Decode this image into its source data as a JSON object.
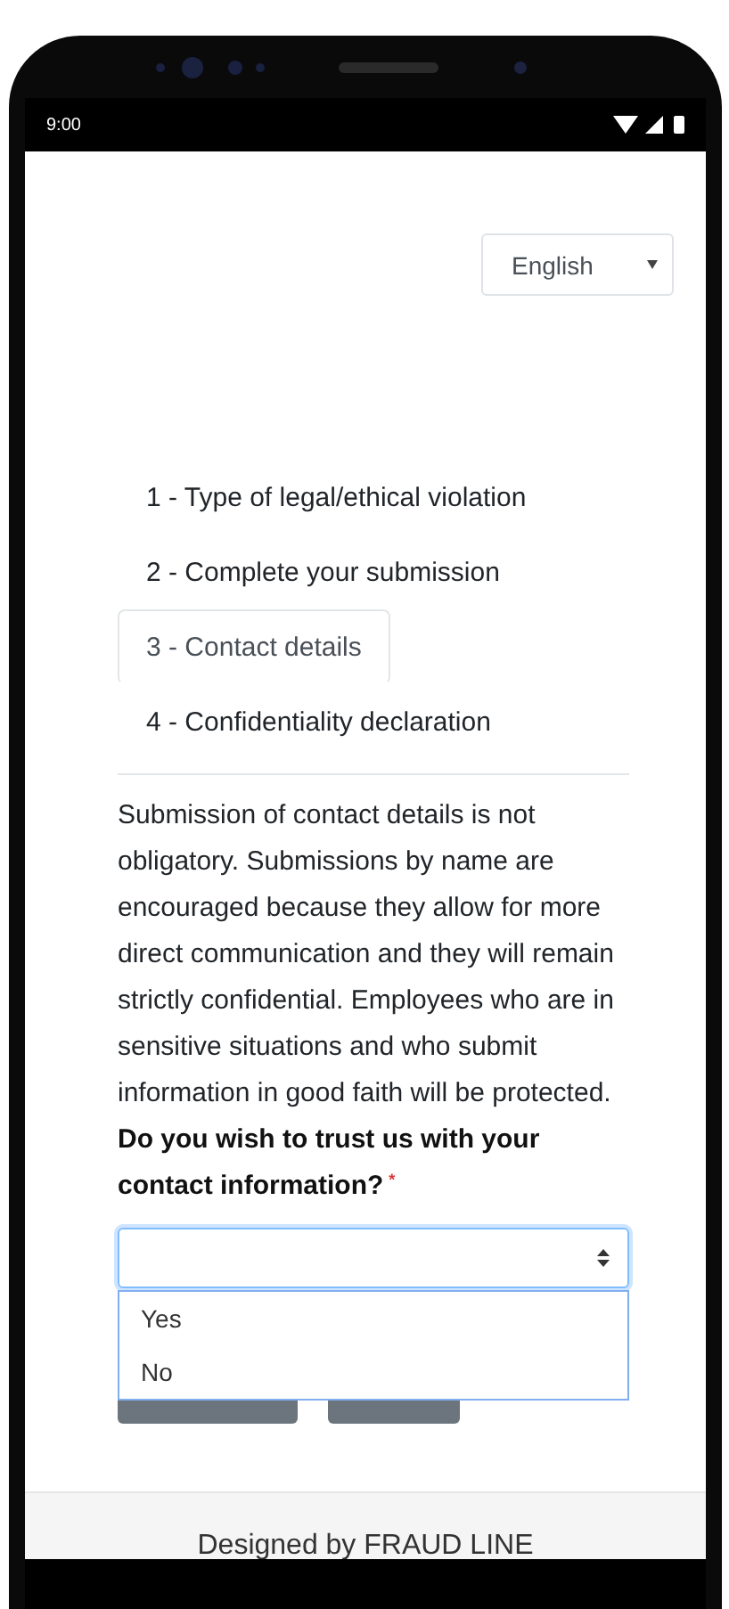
{
  "status_bar": {
    "time": "9:00"
  },
  "language_select": {
    "value": "English"
  },
  "tabs": [
    {
      "label": "1 - Type of legal/ethical violation",
      "selected": false
    },
    {
      "label": "2 - Complete your submission",
      "selected": false
    },
    {
      "label": "3 - Contact details",
      "selected": true
    },
    {
      "label": "4 - Confidentiality declaration",
      "selected": false
    }
  ],
  "intro": "Submission of contact details is not obligatory. Submissions by name are encouraged because they allow for more direct communication and they will remain strictly confidential. Employees who are in sensitive situations and who submit information in good faith will be protected.",
  "question": {
    "label": "Do you wish to trust us with your contact information?",
    "required_mark": "*"
  },
  "contact_select": {
    "options": [
      {
        "label": "Yes",
        "selected": false
      },
      {
        "label": "No",
        "selected": false
      }
    ]
  },
  "footer": {
    "text": "Designed by FRAUD LINE"
  }
}
